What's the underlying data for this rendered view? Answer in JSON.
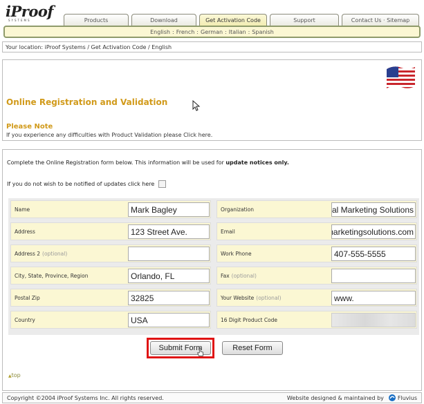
{
  "header": {
    "logo_text": "iProof",
    "logo_sub": "SYSTEMS",
    "tabs": [
      {
        "label": "Products"
      },
      {
        "label": "Download"
      },
      {
        "label": "Get Activation Code"
      },
      {
        "label": "Support"
      },
      {
        "label": "Contact Us · Sitemap"
      }
    ],
    "languages": [
      "English",
      "French",
      "German",
      "Italian",
      "Spanish"
    ],
    "lang_separator": ":"
  },
  "location": {
    "label": "Your location:",
    "path": "iProof Systems / Get Activation Code / English"
  },
  "registration": {
    "title": "Online Registration and Validation",
    "note_title": "Please Note",
    "note_text": "If you experience any difficulties with Product Validation please",
    "note_link": "Click here."
  },
  "form": {
    "intro_text": "Complete the Online Registration form below. This information will be used for",
    "intro_bold": "update notices only.",
    "optout_text": "If you do not wish to be notified of updates click here",
    "fields": {
      "name": {
        "label": "Name",
        "value": "Mark Bagley"
      },
      "organization": {
        "label": "Organization",
        "value": "gital Marketing Solutions"
      },
      "address": {
        "label": "Address",
        "value": "123 Street Ave."
      },
      "email": {
        "label": "Email",
        "value": "marketingsolutions.com"
      },
      "address2": {
        "label": "Address 2",
        "optional": "(optional)",
        "value": ""
      },
      "work_phone": {
        "label": "Work Phone",
        "value": "407-555-5555"
      },
      "city": {
        "label": "City, State, Province, Region",
        "value": "Orlando, FL"
      },
      "fax": {
        "label": "Fax",
        "optional": "(optional)",
        "value": ""
      },
      "postal": {
        "label": "Postal Zip",
        "value": "32825"
      },
      "website": {
        "label": "Your Website",
        "optional": "(optional)",
        "value": "www."
      },
      "country": {
        "label": "Country",
        "value": "USA"
      },
      "product_code": {
        "label": "16 Digit Product Code",
        "value": ""
      }
    },
    "submit_label": "Submit Form",
    "reset_label": "Reset Form",
    "top_link": "top"
  },
  "footer": {
    "copyright": "Copyright ©2004 iProof Systems Inc.   All rights reserved.",
    "credit": "Website designed & maintained by",
    "brand": "Fluvius"
  },
  "colors": {
    "accent_orange": "#d19a1a",
    "label_bg": "#fbf7d3",
    "highlight_red": "#e01414"
  }
}
